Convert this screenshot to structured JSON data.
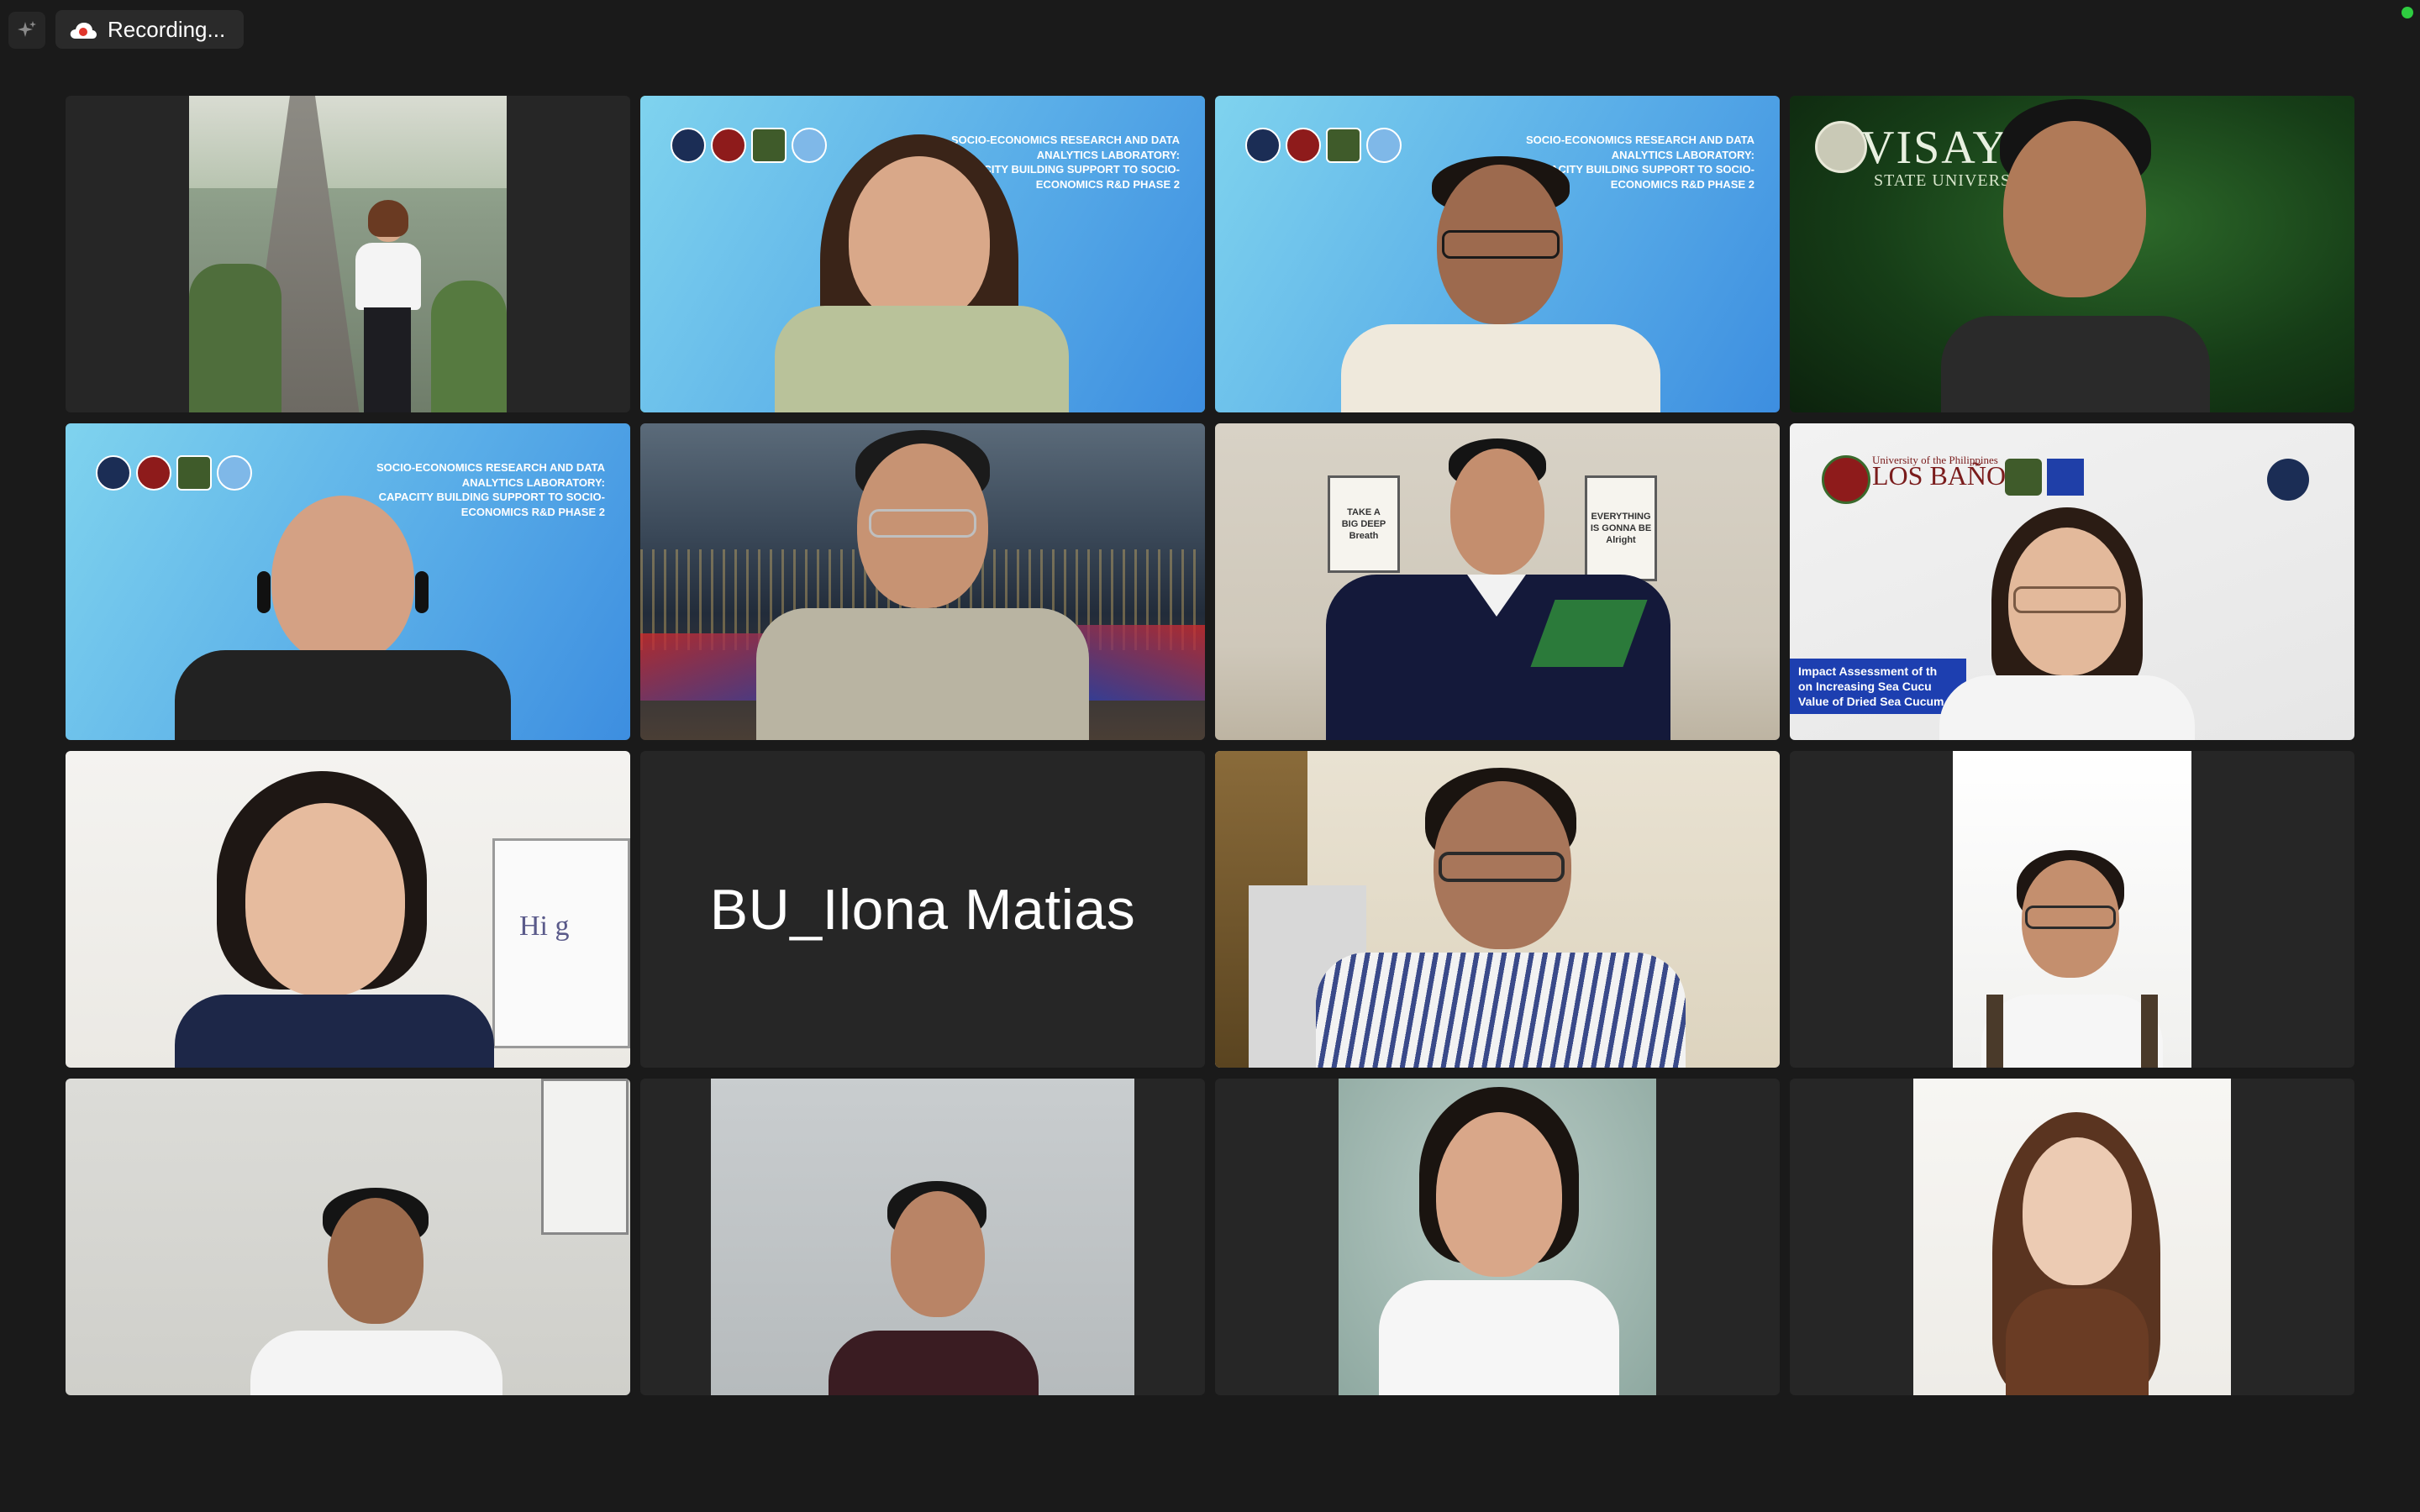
{
  "toolbar": {
    "recording_label": "Recording...",
    "ai_icon": "sparkle-icon",
    "record_icon": "cloud-record-icon",
    "status_color": "#2ecc40"
  },
  "participants": [
    {
      "id": 1,
      "type": "video",
      "background": "outdoor-stone-monument"
    },
    {
      "id": 2,
      "type": "video",
      "background": "lab-banner",
      "active_speaker": true,
      "active_color": "#4cd964"
    },
    {
      "id": 3,
      "type": "video",
      "background": "lab-banner"
    },
    {
      "id": 4,
      "type": "video",
      "background": "vsu-green"
    },
    {
      "id": 5,
      "type": "video",
      "background": "lab-banner"
    },
    {
      "id": 6,
      "type": "video",
      "background": "city-night"
    },
    {
      "id": 7,
      "type": "video",
      "background": "room-posters"
    },
    {
      "id": 8,
      "type": "video",
      "background": "uplb-banner"
    },
    {
      "id": 9,
      "type": "video",
      "background": "whiteboard-room"
    },
    {
      "id": 10,
      "type": "name-only",
      "display_name": "BU_Ilona Matias"
    },
    {
      "id": 11,
      "type": "video",
      "background": "home-room"
    },
    {
      "id": 12,
      "type": "video",
      "background": "white-wall"
    },
    {
      "id": 13,
      "type": "video",
      "background": "office-wall"
    },
    {
      "id": 14,
      "type": "video",
      "background": "grey-wall"
    },
    {
      "id": 15,
      "type": "video",
      "background": "studio-teal"
    },
    {
      "id": 16,
      "type": "video",
      "background": "plain-studio"
    }
  ],
  "banners": {
    "lab_line1": "SOCIO-ECONOMICS RESEARCH AND DATA ANALYTICS LABORATORY:",
    "lab_line2": "CAPACITY BUILDING SUPPORT TO SOCIO-ECONOMICS R&D PHASE 2",
    "vsu_title": "VISAYA",
    "vsu_subtitle": "STATE UNIVERS",
    "uplb_small": "University of the Philippines",
    "uplb_title": "LOS BAÑOS",
    "impact_line1": "Impact Assessment of th",
    "impact_line2": "on Increasing Sea Cucu",
    "impact_line3": "Value of Dried Sea Cucum",
    "poster1_line1": "TAKE A",
    "poster1_line2": "BIG DEEP",
    "poster1_line3": "Breath",
    "poster2_line1": "EVERYTHING",
    "poster2_line2": "IS GONNA BE",
    "poster2_line3": "Alright",
    "whiteboard_text": "Hi g"
  }
}
